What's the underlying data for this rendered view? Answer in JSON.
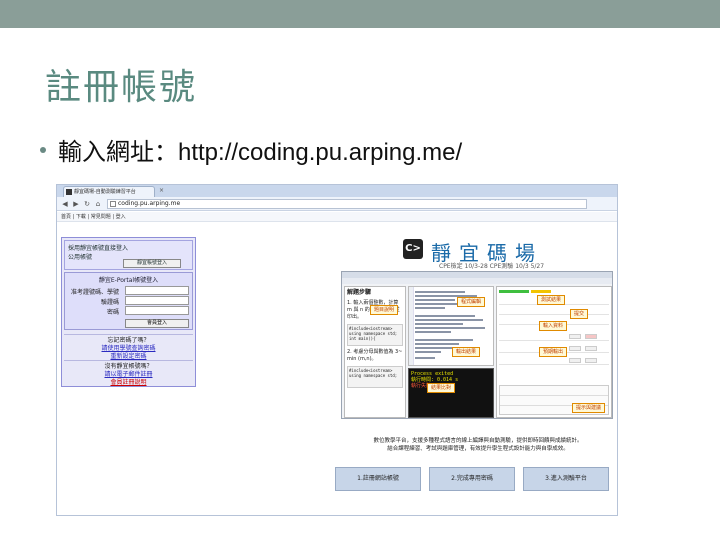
{
  "slide": {
    "title": "註冊帳號",
    "bullet": "輸入網址：http://coding.pu.arping.me/"
  },
  "browser": {
    "tab_title": "靜宜碼場-自動測驗練習平台",
    "url": "coding.pu.arping.me",
    "bookmarks": "首頁 | 下載 | 常見問題 | 登入"
  },
  "login": {
    "hint_line1": "採用靜宜帳號直接登入",
    "hint_line2": "公用帳號",
    "hint_button": "靜宜帳號登入",
    "box_title": "靜宜E-Portal帳號登入",
    "label_user": "准考證號碼、學號",
    "label_pass": "驗證碼",
    "label_captcha": "密碼",
    "login_button": "會員登入",
    "forgot_title": "忘記密碼了嗎？",
    "forgot_link1": "請使用學號查詢密碼",
    "forgot_link2": "重新設定密碼",
    "register_title": "沒有靜宜帳號嗎？",
    "register_link1": "請以電子郵件註冊",
    "register_link2": "會員註冊說明"
  },
  "site": {
    "logo_glyph": "C>",
    "name": "靜宜碼場",
    "subtitle": "CPE檢定 10/3-28 CPE測驗 10/3 5/27"
  },
  "app": {
    "problem_title": "解題步驟",
    "step1": "1. 輸入兩個整數，計算 m 與 n 的最大公因數並印出。",
    "step2": "2. 考慮分母與數值為 3~ min (m,n)。",
    "code1": "#include<iostream>\nusing namespace std;\nint main(){",
    "code2": "#include<iostream>\nusing namespace std;",
    "console_line1": "Process exited",
    "console_line2": "執行時間: 0.014 s",
    "console_err": "執行失敗"
  },
  "callouts": {
    "problem": "題目說明",
    "editor": "程式編輯",
    "result": "測試結果",
    "submit": "提交",
    "input": "輸入資料",
    "output": "輸出結果",
    "expected": "預期輸出",
    "compare": "結果比對",
    "hint": "提示與建議"
  },
  "explanation": {
    "line1": "數位教學平台，支援多種程式語言的線上編譯與自動測驗，提供即時回饋與成績統計。",
    "line2": "結合課程練習、考試與題庫管理，有效提升學生程式設計能力與自學成效。"
  },
  "steps": [
    {
      "label": "1.註冊網站帳號"
    },
    {
      "label": "2.完成專用密碼"
    },
    {
      "label": "3.進入測驗平台"
    }
  ]
}
